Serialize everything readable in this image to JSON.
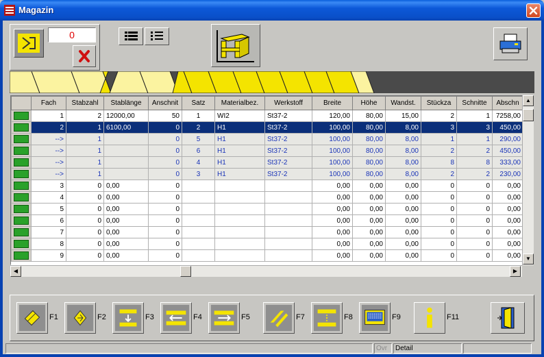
{
  "window": {
    "title": "Magazin"
  },
  "toolbar": {
    "counter_value": "0"
  },
  "fkeys": [
    "F1",
    "F2",
    "F3",
    "F4",
    "F5",
    "F7",
    "F8",
    "F9",
    "F11"
  ],
  "table": {
    "columns": [
      "Fach",
      "Stabzahl",
      "Stablänge",
      "Anschnit",
      "Satz",
      "Materialbez.",
      "Werkstoff",
      "Breite",
      "Höhe",
      "Wandst.",
      "Stückza",
      "Schnitte",
      "Abschn"
    ],
    "rows": [
      [
        "1",
        "2",
        "12000,00",
        "50",
        "1",
        "WI2",
        "St37-2",
        "120,00",
        "80,00",
        "15,00",
        "2",
        "1",
        "7258,00"
      ],
      [
        "2",
        "1",
        "6100,00",
        "0",
        "2",
        "H1",
        "St37-2",
        "100,00",
        "80,00",
        "8,00",
        "3",
        "3",
        "450,00"
      ],
      [
        "-->",
        "1",
        "",
        "0",
        "5",
        "H1",
        "St37-2",
        "100,00",
        "80,00",
        "8,00",
        "1",
        "1",
        "290,00"
      ],
      [
        "-->",
        "1",
        "",
        "0",
        "6",
        "H1",
        "St37-2",
        "100,00",
        "80,00",
        "8,00",
        "2",
        "2",
        "450,00"
      ],
      [
        "-->",
        "1",
        "",
        "0",
        "4",
        "H1",
        "St37-2",
        "100,00",
        "80,00",
        "8,00",
        "8",
        "8",
        "333,00"
      ],
      [
        "-->",
        "1",
        "",
        "0",
        "3",
        "H1",
        "St37-2",
        "100,00",
        "80,00",
        "8,00",
        "2",
        "2",
        "230,00"
      ],
      [
        "3",
        "0",
        "0,00",
        "0",
        "",
        "",
        "",
        "0,00",
        "0,00",
        "0,00",
        "0",
        "0",
        "0,00"
      ],
      [
        "4",
        "0",
        "0,00",
        "0",
        "",
        "",
        "",
        "0,00",
        "0,00",
        "0,00",
        "0",
        "0",
        "0,00"
      ],
      [
        "5",
        "0",
        "0,00",
        "0",
        "",
        "",
        "",
        "0,00",
        "0,00",
        "0,00",
        "0",
        "0",
        "0,00"
      ],
      [
        "6",
        "0",
        "0,00",
        "0",
        "",
        "",
        "",
        "0,00",
        "0,00",
        "0,00",
        "0",
        "0",
        "0,00"
      ],
      [
        "7",
        "0",
        "0,00",
        "0",
        "",
        "",
        "",
        "0,00",
        "0,00",
        "0,00",
        "0",
        "0",
        "0,00"
      ],
      [
        "8",
        "0",
        "0,00",
        "0",
        "",
        "",
        "",
        "0,00",
        "0,00",
        "0,00",
        "0",
        "0",
        "0,00"
      ],
      [
        "9",
        "0",
        "0,00",
        "0",
        "",
        "",
        "",
        "0,00",
        "0,00",
        "0,00",
        "0",
        "0",
        "0,00"
      ]
    ],
    "row_types": [
      "normal",
      "selected",
      "sub",
      "sub",
      "sub",
      "sub",
      "normal",
      "normal",
      "normal",
      "normal",
      "normal",
      "normal",
      "normal"
    ]
  },
  "statusbar": {
    "ovr": "Ovr",
    "detail": "Detail"
  },
  "colors": {
    "title_blue": "#0a4fc8",
    "selection": "#0b2f7a",
    "sub_text": "#1a34b8",
    "indicator_green": "#2aa12a",
    "segment_yellow": "#f4e400",
    "segment_pale": "#fbf3a0",
    "counter_red": "#e00000"
  }
}
